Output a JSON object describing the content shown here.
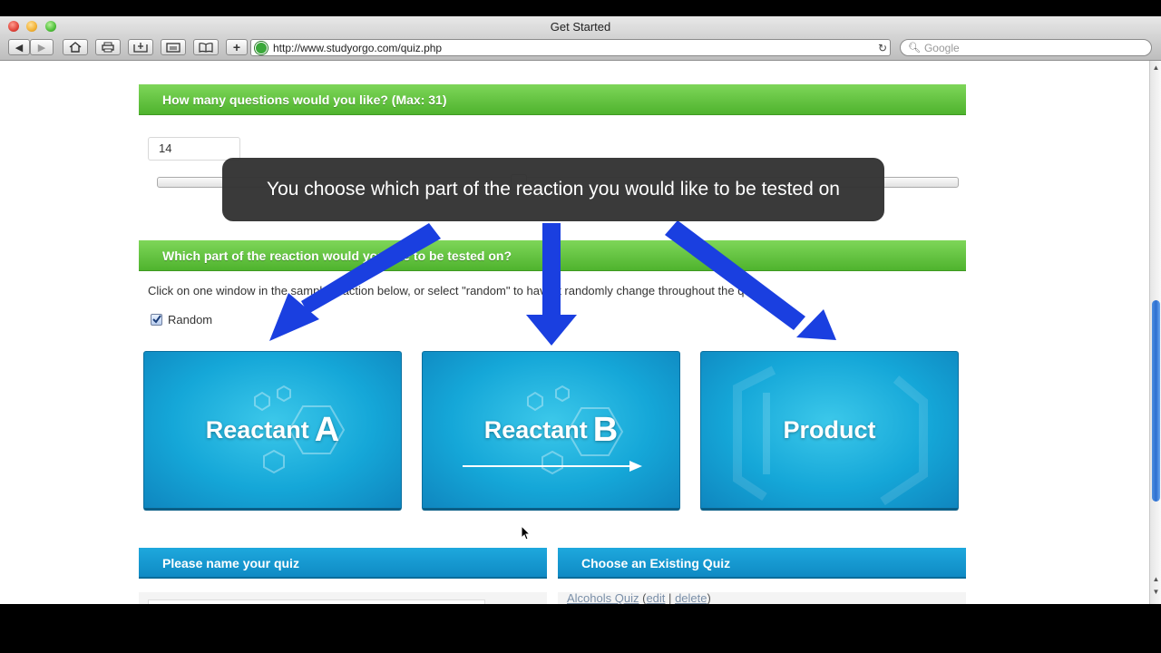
{
  "window": {
    "title": "Get Started",
    "url": "http://www.studyorgo.com/quiz.php",
    "search_placeholder": "Google"
  },
  "toolbar": {
    "buttons": [
      "back-icon",
      "forward-icon",
      "home-icon",
      "print-icon",
      "bookmark-add-icon",
      "reader-icon",
      "book-icon",
      "add-tab-icon"
    ]
  },
  "questions": {
    "header": "How many questions would you like? (Max: 31)",
    "value": "14",
    "slider_fraction": 0.45
  },
  "reaction": {
    "header": "Which part of the reaction would you like to be tested on?",
    "instruction": "Click on one window in the sample reaction below, or select \"random\" to have it randomly change throughout the quiz.",
    "random_label": "Random",
    "random_checked": true,
    "tiles": [
      {
        "label": "Reactant",
        "letter": "A"
      },
      {
        "label": "Reactant",
        "letter": "B"
      },
      {
        "label": "Product",
        "letter": ""
      }
    ]
  },
  "callout": {
    "text": "You choose which part of the reaction you would like to be tested on"
  },
  "name_quiz": {
    "header": "Please name your quiz"
  },
  "existing_quiz": {
    "header": "Choose an Existing Quiz",
    "item_name": "Alcohols Quiz",
    "edit": "edit",
    "separator": "|",
    "delete": "delete",
    "open_paren": "(",
    "close_paren": ")"
  },
  "colors": {
    "green_header": "#5cbf3a",
    "blue_header": "#1198d2",
    "tile": "#15a7d8",
    "arrow": "#1a3fe0",
    "callout_bg": "#343434"
  }
}
